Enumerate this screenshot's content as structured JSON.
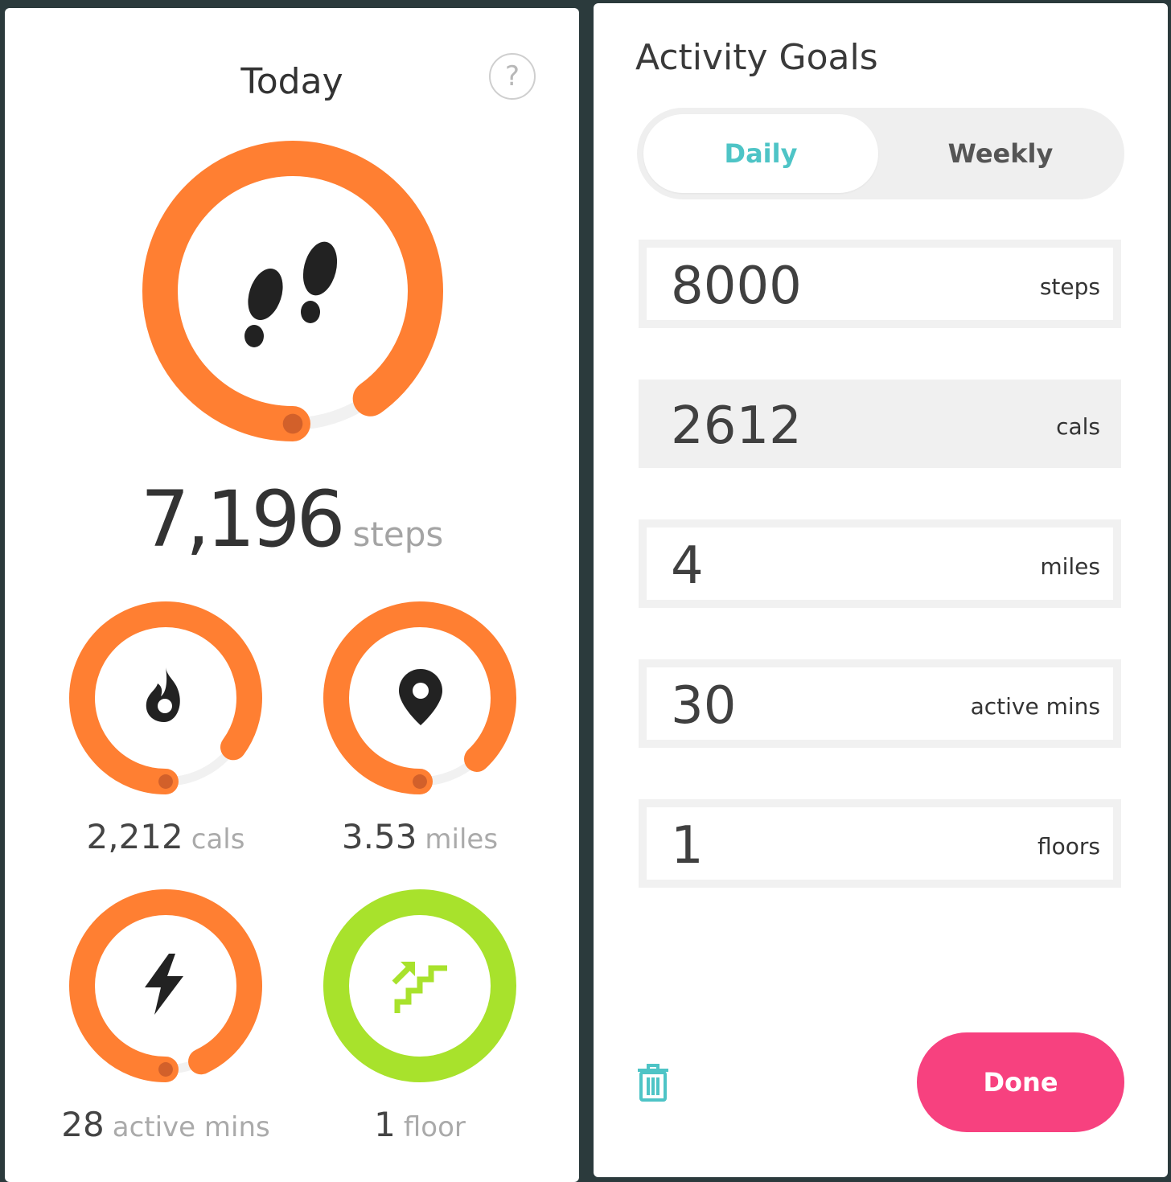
{
  "today": {
    "title": "Today",
    "help_label": "?",
    "steps": {
      "value": "7,196",
      "unit": "steps",
      "progress": 0.9
    },
    "metrics": [
      {
        "name": "calories",
        "value": "2,212",
        "unit": "cals",
        "progress": 0.85,
        "icon": "flame-icon"
      },
      {
        "name": "distance",
        "value": "3.53",
        "unit": "miles",
        "progress": 0.88,
        "icon": "location-pin-icon"
      },
      {
        "name": "active-minutes",
        "value": "28",
        "unit": "active mins",
        "progress": 0.93,
        "icon": "lightning-icon"
      },
      {
        "name": "floors",
        "value": "1",
        "unit": "floor",
        "progress": 1.0,
        "icon": "stairs-icon"
      }
    ]
  },
  "goals": {
    "title": "Activity Goals",
    "tabs": [
      {
        "label": "Daily",
        "selected": true
      },
      {
        "label": "Weekly",
        "selected": false
      }
    ],
    "fields": [
      {
        "value": "8000",
        "unit": "steps"
      },
      {
        "value": "2612",
        "unit": "cals"
      },
      {
        "value": "4",
        "unit": "miles"
      },
      {
        "value": "30",
        "unit": "active mins"
      },
      {
        "value": "1",
        "unit": "floors"
      }
    ],
    "done_label": "Done",
    "delete_icon": "trash-icon"
  },
  "colors": {
    "ring_orange": "#ff7f32",
    "ring_green": "#a8e22c",
    "track": "#f1f1f1",
    "accent_teal": "#4ec4c6",
    "done_pink": "#f7417f"
  }
}
